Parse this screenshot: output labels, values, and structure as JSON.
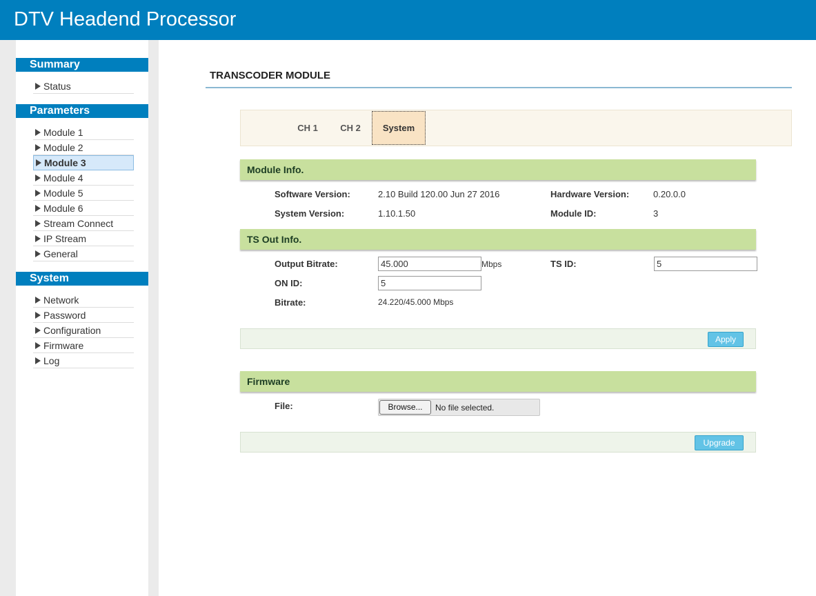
{
  "app": {
    "title": "DTV Headend Processor"
  },
  "sidebar": {
    "summary": {
      "title": "Summary",
      "items": [
        "Status"
      ]
    },
    "parameters": {
      "title": "Parameters",
      "items": [
        "Module 1",
        "Module 2",
        "Module 3",
        "Module 4",
        "Module 5",
        "Module 6",
        "Stream Connect",
        "IP Stream",
        "General"
      ],
      "active": "Module 3"
    },
    "system": {
      "title": "System",
      "items": [
        "Network",
        "Password",
        "Configuration",
        "Firmware",
        "Log"
      ]
    }
  },
  "page": {
    "title": "TRANSCODER MODULE"
  },
  "tabs": [
    "CH 1",
    "CH 2",
    "System"
  ],
  "active_tab": "System",
  "module_info": {
    "title": "Module Info.",
    "software_version_label": "Software Version:",
    "software_version": "2.10 Build 120.00 Jun 27 2016",
    "hardware_version_label": "Hardware Version:",
    "hardware_version": "0.20.0.0",
    "system_version_label": "System Version:",
    "system_version": "1.10.1.50",
    "module_id_label": "Module ID:",
    "module_id": "3"
  },
  "ts_out": {
    "title": "TS Out Info.",
    "output_bitrate_label": "Output Bitrate:",
    "output_bitrate": "45.000",
    "output_bitrate_unit": "Mbps",
    "ts_id_label": "TS ID:",
    "ts_id": "5",
    "on_id_label": "ON ID:",
    "on_id": "5",
    "bitrate_label": "Bitrate:",
    "bitrate": "24.220/45.000 Mbps",
    "apply_label": "Apply"
  },
  "firmware": {
    "title": "Firmware",
    "file_label": "File:",
    "browse_label": "Browse...",
    "no_file_text": "No file selected.",
    "upgrade_label": "Upgrade"
  },
  "colors": {
    "header": "#007fbe",
    "section_bar": "#c8e09e",
    "button": "#62c3e6",
    "active_tab": "#f9e3c4"
  }
}
